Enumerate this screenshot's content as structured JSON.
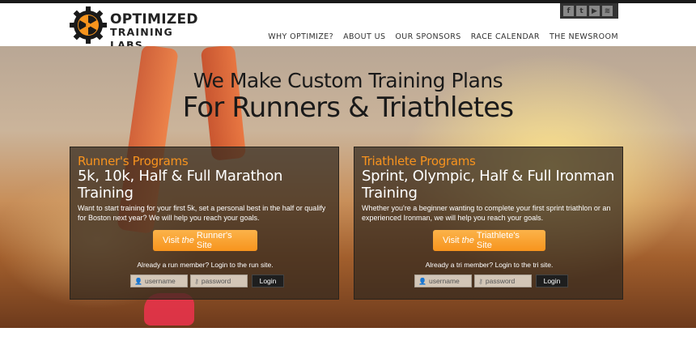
{
  "logo": {
    "line1": "OPTIMIZED",
    "line2": "TRAINING LABS"
  },
  "social": {
    "icons": [
      "facebook-icon",
      "twitter-icon",
      "youtube-icon",
      "rss-icon"
    ],
    "glyphs": [
      "f",
      "t",
      "▶",
      "≋"
    ]
  },
  "nav": [
    "WHY OPTIMIZE?",
    "ABOUT US",
    "OUR SPONSORS",
    "RACE CALENDAR",
    "THE NEWSROOM"
  ],
  "hero": {
    "line1": "We Make Custom Training Plans",
    "line2": "For Runners & Triathletes"
  },
  "runner": {
    "kicker": "Runner's Programs",
    "title": "5k, 10k, Half & Full Marathon Training",
    "desc": "Want to start training for your first 5k, set a personal best in the half or qualify for Boston next year? We will help you reach your goals.",
    "btn_pre": "Visit",
    "btn_em": "the",
    "btn_post": "Runner's Site",
    "note": "Already a run member? Login to the run site.",
    "username_placeholder": "username",
    "password_placeholder": "password",
    "login": "Login"
  },
  "triathlete": {
    "kicker": "Triathlete Programs",
    "title": "Sprint, Olympic, Half & Full Ironman Training",
    "desc": "Whether you're a beginner wanting to complete your first sprint triathlon or an experienced Ironman, we will help you reach your goals.",
    "btn_pre": "Visit",
    "btn_em": "the",
    "btn_post": "Triathlete's Site",
    "note": "Already a tri member? Login to the tri site.",
    "username_placeholder": "username",
    "password_placeholder": "password",
    "login": "Login"
  },
  "colors": {
    "accent": "#f7931e",
    "dark": "#1a1a1a"
  }
}
